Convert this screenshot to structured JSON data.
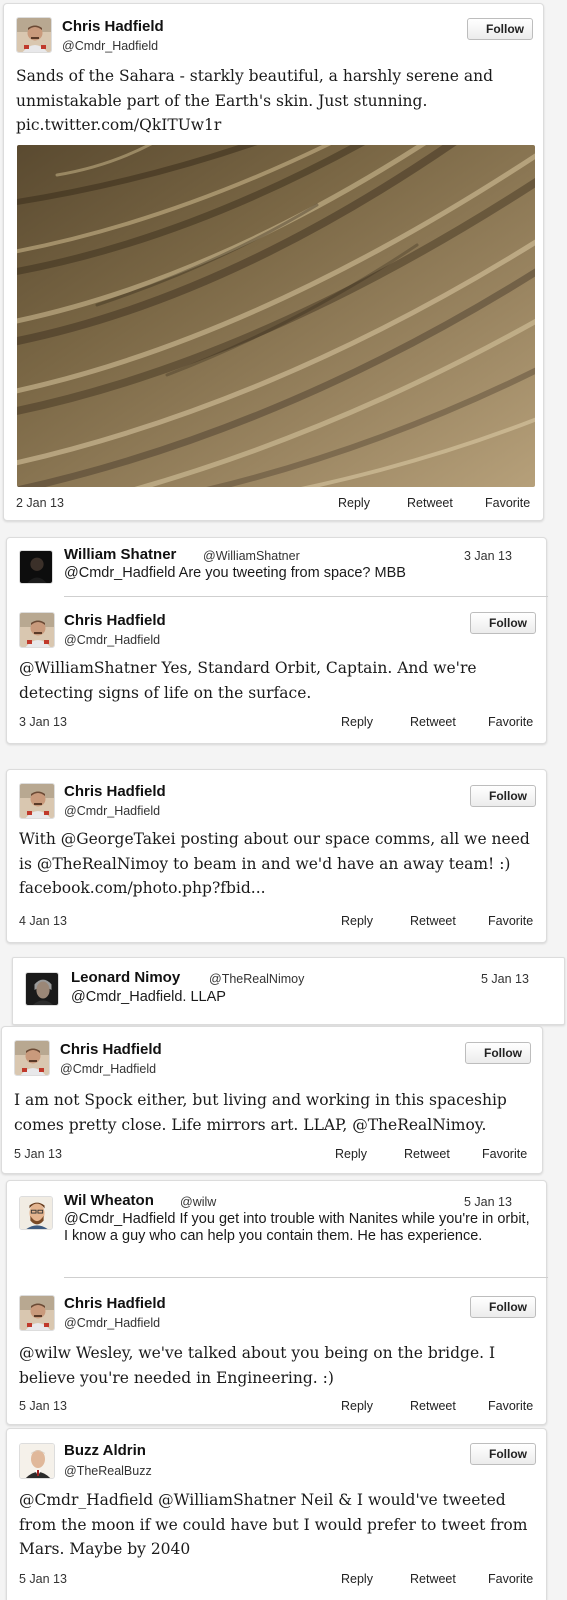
{
  "tweets": [
    {
      "author": "Chris Hadfield",
      "handle": "@Cmdr_Hadfield",
      "follow": "Follow",
      "text": "Sands of the Sahara - starkly beautiful, a harshly serene and unmistakable part of the Earth's skin. Just stunning. pic.twitter.com/QkITUw1r",
      "date": "2 Jan 13",
      "actions": {
        "reply": "Reply",
        "retweet": "Retweet",
        "favorite": "Favorite"
      }
    },
    {
      "in_reply_to": {
        "author": "William Shatner",
        "handle": "@WilliamShatner",
        "date": "3 Jan 13",
        "text": "@Cmdr_Hadfield Are you tweeting from space? MBB"
      },
      "author": "Chris Hadfield",
      "handle": "@Cmdr_Hadfield",
      "follow": "Follow",
      "text": "@WilliamShatner Yes, Standard Orbit, Captain. And we're detecting signs of life on the surface.",
      "date": "3 Jan 13",
      "actions": {
        "reply": "Reply",
        "retweet": "Retweet",
        "favorite": "Favorite"
      }
    },
    {
      "author": "Chris Hadfield",
      "handle": "@Cmdr_Hadfield",
      "follow": "Follow",
      "text": "With @GeorgeTakei posting about our space comms, all we need is @TheRealNimoy to beam in and we'd have an away team! :) facebook.com/photo.php?fbid...",
      "date": "4 Jan 13",
      "actions": {
        "reply": "Reply",
        "retweet": "Retweet",
        "favorite": "Favorite"
      }
    },
    {
      "in_reply_to": {
        "author": "Leonard Nimoy",
        "handle": "@TheRealNimoy",
        "date": "5 Jan 13",
        "text": "@Cmdr_Hadfield. LLAP"
      },
      "author": "Chris Hadfield",
      "handle": "@Cmdr_Hadfield",
      "follow": "Follow",
      "text": "I am not Spock either, but living and working in this spaceship comes pretty close. Life mirrors art. LLAP, @TheRealNimoy.",
      "date": "5 Jan 13",
      "actions": {
        "reply": "Reply",
        "retweet": "Retweet",
        "favorite": "Favorite"
      }
    },
    {
      "in_reply_to": {
        "author": "Wil Wheaton",
        "handle": "@wilw",
        "date": "5 Jan 13",
        "text": "@Cmdr_Hadfield If you get into trouble with Nanites while you're in orbit, I know a guy who can help you contain them. He has experience."
      },
      "author": "Chris Hadfield",
      "handle": "@Cmdr_Hadfield",
      "follow": "Follow",
      "text": "@wilw Wesley, we've talked about you being on the bridge. I believe you're needed in Engineering. :)",
      "date": "5 Jan 13",
      "actions": {
        "reply": "Reply",
        "retweet": "Retweet",
        "favorite": "Favorite"
      }
    },
    {
      "author": "Buzz Aldrin",
      "handle": "@TheRealBuzz",
      "follow": "Follow",
      "text": "@Cmdr_Hadfield @WilliamShatner Neil & I would've tweeted from the moon if we could have but I would prefer to tweet from Mars. Maybe by 2040",
      "date": "5 Jan 13",
      "actions": {
        "reply": "Reply",
        "retweet": "Retweet",
        "favorite": "Favorite"
      }
    }
  ],
  "colors": {
    "background": "#f4f4f4",
    "card": "#ffffff",
    "sand": "#8f7a55"
  }
}
